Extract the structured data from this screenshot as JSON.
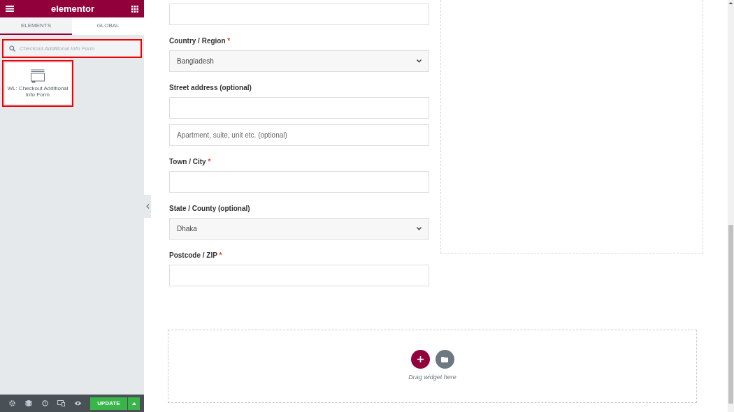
{
  "panel": {
    "logo": "elementor",
    "tabs": [
      {
        "label": "ELEMENTS",
        "selected": true
      },
      {
        "label": "GLOBAL",
        "selected": false
      }
    ],
    "search": {
      "placeholder": "Checkout Additional Info Form"
    },
    "widgets": [
      {
        "label": "WL: Checkout Additional info Form"
      }
    ],
    "footer": {
      "update": "UPDATE"
    }
  },
  "form": {
    "fields": [
      {
        "kind": "input"
      },
      {
        "kind": "select",
        "label": "Country / Region",
        "required_mark": "*",
        "value": "Bangladesh"
      },
      {
        "kind": "input",
        "label": "Street address (optional)"
      },
      {
        "kind": "input",
        "placeholder": "Apartment, suite, unit etc. (optional)"
      },
      {
        "kind": "input",
        "label": "Town / City",
        "required_mark": "*"
      },
      {
        "kind": "select",
        "label": "State / County (optional)",
        "value": "Dhaka"
      },
      {
        "kind": "input",
        "label": "Postcode / ZIP",
        "required_mark": "*"
      }
    ]
  },
  "drop_zone": {
    "hint": "Drag widget here"
  }
}
